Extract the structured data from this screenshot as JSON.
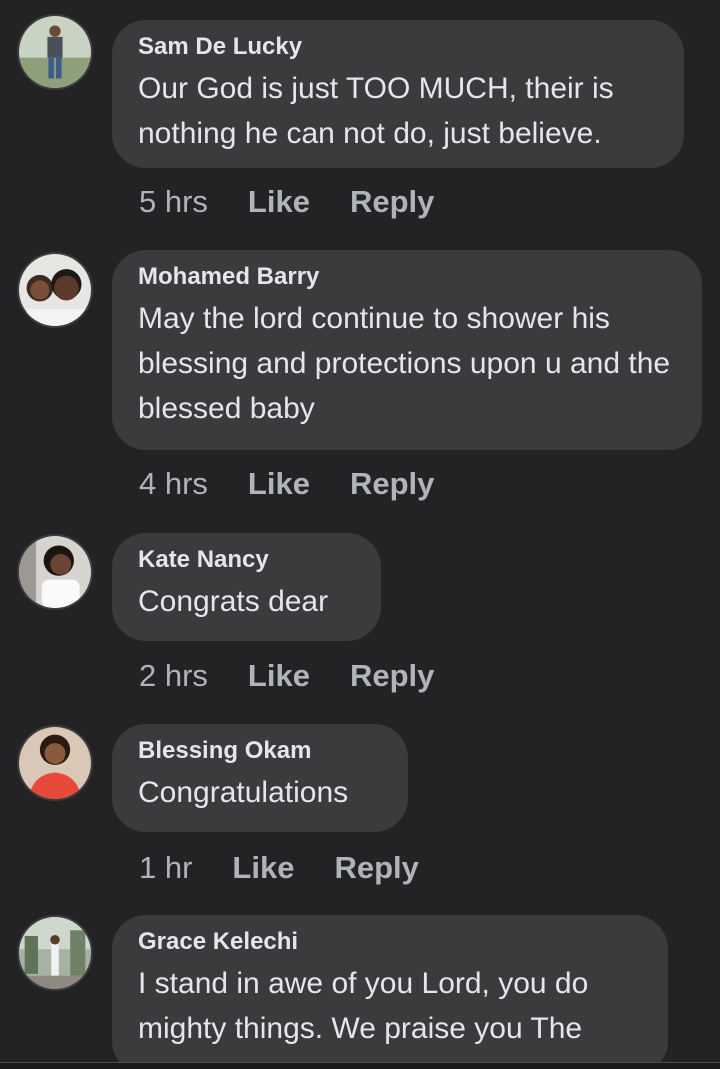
{
  "comments": [
    {
      "author": "Sam De Lucky",
      "text": "Our God is just TOO MUCH, their is nothing he can not do, just believe.",
      "time": "5 hrs",
      "like": "Like",
      "reply": "Reply"
    },
    {
      "author": "Mohamed Barry",
      "text": "May the lord continue to shower his blessing and protections upon u and the blessed baby",
      "time": "4 hrs",
      "like": "Like",
      "reply": "Reply"
    },
    {
      "author": "Kate Nancy",
      "text": "Congrats dear",
      "time": "2 hrs",
      "like": "Like",
      "reply": "Reply"
    },
    {
      "author": "Blessing Okam",
      "text": "Congratulations",
      "time": "1 hr",
      "like": "Like",
      "reply": "Reply"
    },
    {
      "author": "Grace Kelechi",
      "text": "I stand in awe of you Lord, you do mighty things. We praise you The"
    }
  ]
}
